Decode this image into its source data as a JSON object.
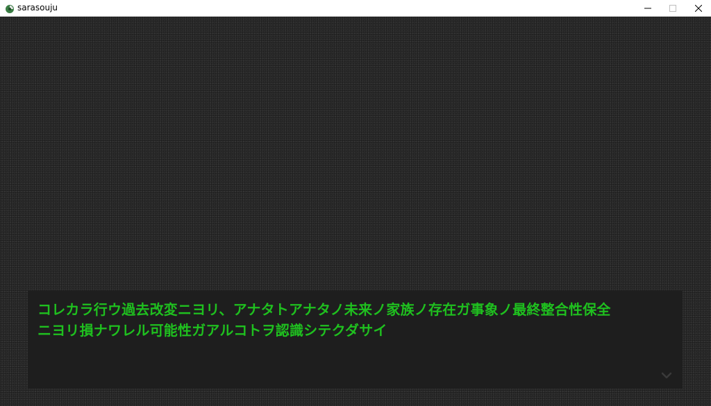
{
  "window": {
    "title": "sarasouju",
    "icon": "app-icon",
    "controls": [
      "minimize-icon",
      "maximize-icon",
      "close-icon"
    ]
  },
  "dialogue": {
    "lines": [
      "コレカラ行ウ過去改変ニヨリ、アナタトアナタノ未来ノ家族ノ存在ガ事象ノ最終整合性保全",
      "ニヨリ損ナワレル可能性ガアルコトヲ認識シテクダサイ"
    ],
    "text_color": "#1fc01f",
    "advance_indicator": "chevron-down-icon"
  },
  "colors": {
    "background": "#2c2c2c",
    "message_box": "#1e1e1e"
  }
}
